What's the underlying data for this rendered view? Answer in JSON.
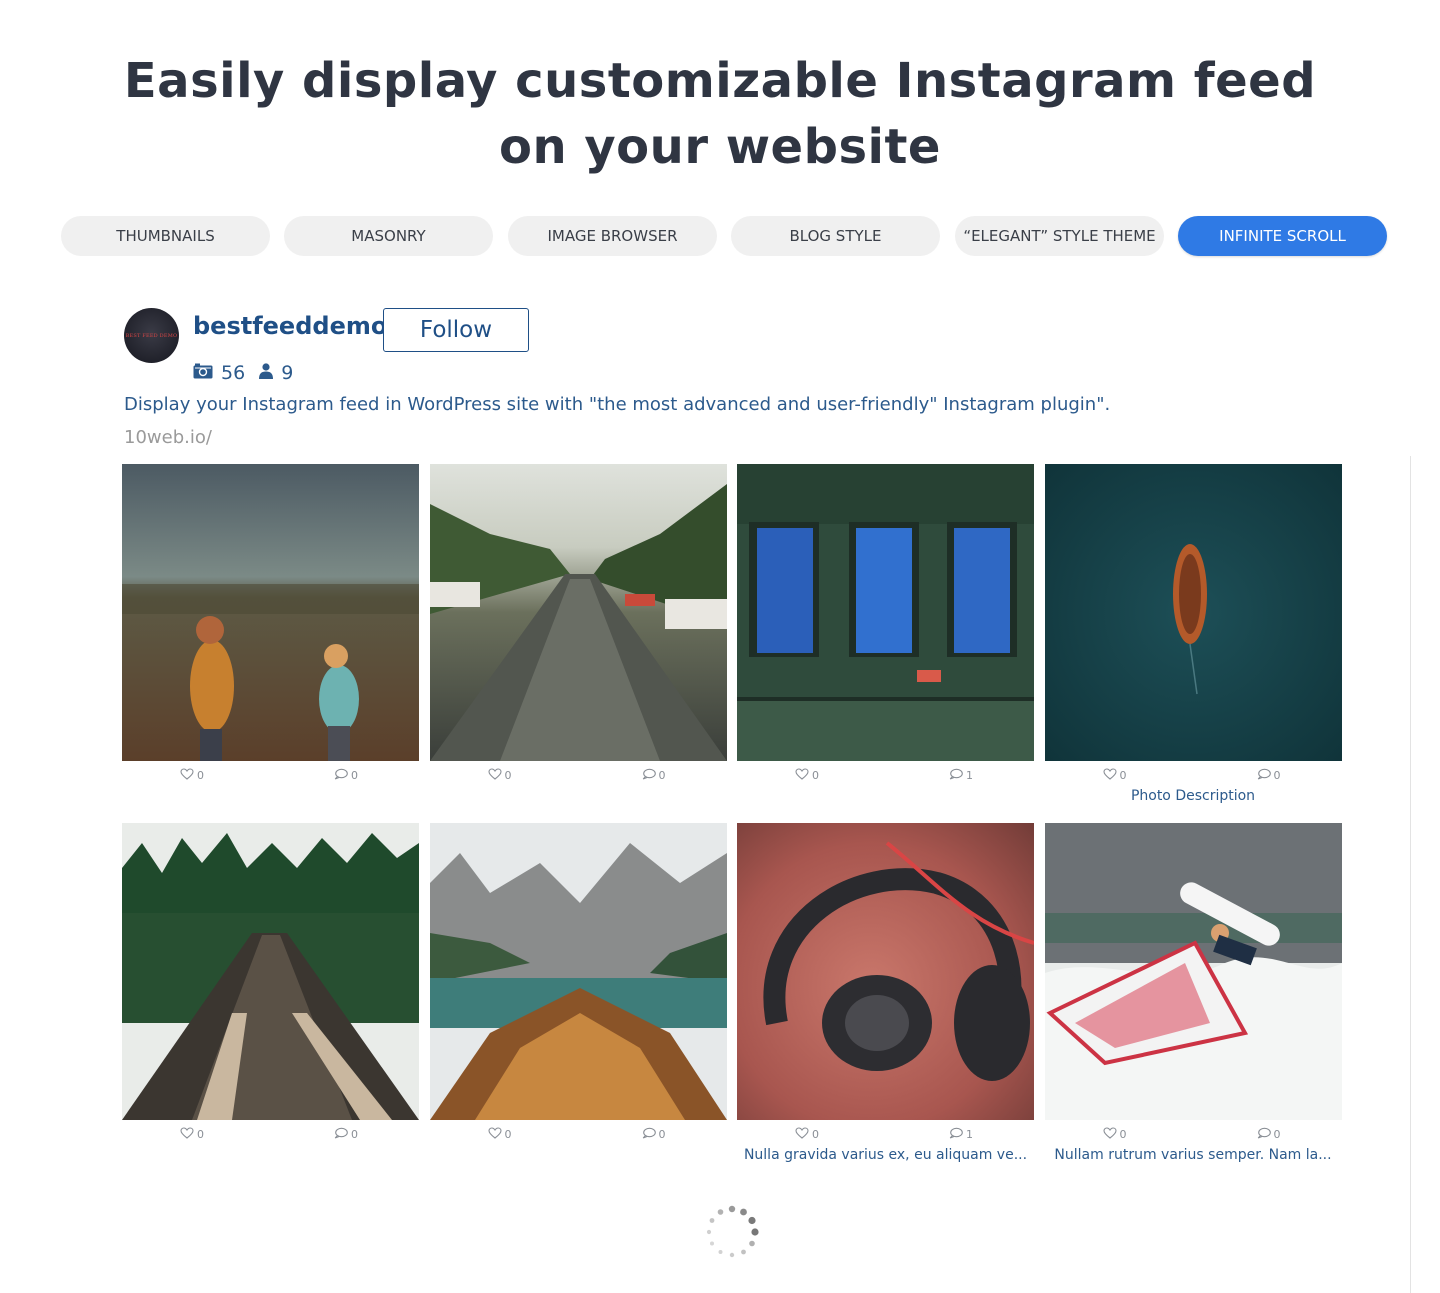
{
  "headline": {
    "line1": "Easily display customizable Instagram feed",
    "line2": "on your website"
  },
  "tabs": [
    {
      "label": "THUMBNAILS",
      "active": false
    },
    {
      "label": "MASONRY",
      "active": false
    },
    {
      "label": "IMAGE BROWSER",
      "active": false
    },
    {
      "label": "BLOG STYLE",
      "active": false
    },
    {
      "label": "“ELEGANT” STYLE THEME",
      "active": false
    },
    {
      "label": "INFINITE SCROLL",
      "active": true
    }
  ],
  "colors": {
    "accent": "#2f7ae5",
    "link": "#1f4f86",
    "text": "#2f3542"
  },
  "profile": {
    "avatar_text": "BEST FEED DEMO",
    "username": "bestfeeddemo",
    "follow_label": "Follow",
    "posts_icon": "camera-icon",
    "posts_count": "56",
    "followers_icon": "user-icon",
    "followers_count": "9",
    "bio": "Display your Instagram feed in WordPress site with \"the most advanced and user-friendly\" Instagram plugin\".",
    "website": "10web.io/"
  },
  "feed": [
    {
      "scene": "children-in-field",
      "likes": "0",
      "comments": "0",
      "description": ""
    },
    {
      "scene": "canal-with-boats",
      "likes": "0",
      "comments": "0",
      "description": ""
    },
    {
      "scene": "green-wall-windows",
      "likes": "0",
      "comments": "1",
      "description": ""
    },
    {
      "scene": "boat-on-sea",
      "likes": "0",
      "comments": "0",
      "description": "Photo Description"
    },
    {
      "scene": "forest-bridge",
      "likes": "0",
      "comments": "0",
      "description": ""
    },
    {
      "scene": "mountain-lake-boat",
      "likes": "0",
      "comments": "0",
      "description": ""
    },
    {
      "scene": "headphones",
      "likes": "0",
      "comments": "1",
      "description": "Nulla gravida varius ex, eu aliquam ve..."
    },
    {
      "scene": "windsurfer",
      "likes": "0",
      "comments": "0",
      "description": "Nullam rutrum varius semper. Nam la..."
    }
  ],
  "icons": {
    "like": "heart-icon",
    "comment": "comment-icon",
    "loader": "loading-spinner-icon"
  }
}
